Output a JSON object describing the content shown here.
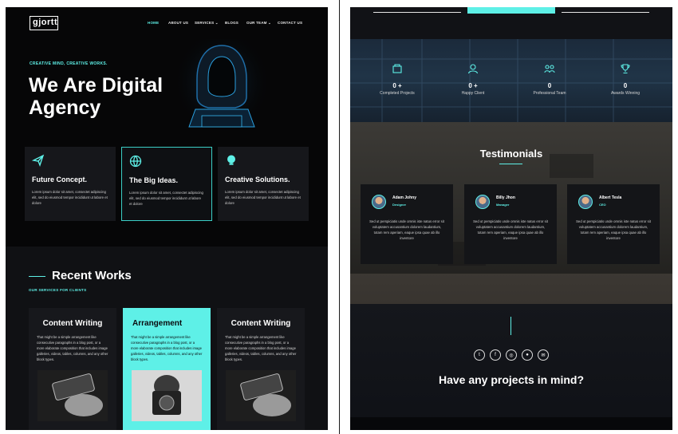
{
  "colors": {
    "accent": "#5ef0e7",
    "dark": "#0b0c10",
    "card": "#16171b"
  },
  "header": {
    "logo": "gjortt",
    "nav": [
      {
        "label": "HOME",
        "active": true
      },
      {
        "label": "ABOUT US"
      },
      {
        "label": "SERVICES ⌄"
      },
      {
        "label": "BLOGS"
      },
      {
        "label": "OUR TEAM ⌄"
      },
      {
        "label": "CONTACT US"
      }
    ]
  },
  "hero": {
    "eyebrow": "CREATIVE MIND, CREATIVE WORKS.",
    "title": "We Are Digital Agency",
    "image_icon": "hooded-hacker-illustration"
  },
  "features": [
    {
      "icon": "paper-plane-icon",
      "title": "Future Concept.",
      "desc": "Lorem ipsum dolor sit amet, consectet adipiscing elit, sed do eiusmod tempor incididunt ut labore et dolore"
    },
    {
      "icon": "globe-icon",
      "title": "The Big Ideas.",
      "desc": "Lorem ipsum dolor sit amet, consectet adipiscing elit, sed do eiusmod tempor incididunt ut labore et dolore"
    },
    {
      "icon": "lightbulb-icon",
      "title": "Creative Solutions.",
      "desc": "Lorem ipsum dolor sit amet, consectet adipiscing elit, sed do eiusmod tempor incididunt ut labore et dolore"
    }
  ],
  "works": {
    "title": "Recent Works",
    "subtitle": "OUR SERVICES FOR CLIENTS",
    "cards": [
      {
        "title": "Content Writing",
        "desc": "That might be a simple arrangement like consecutive paragraphs in a blog post, or a more elaborate composition that includes image galleries, videos, tables, columns, and any other block types."
      },
      {
        "title": "Arrangement",
        "desc": "That might be a simple arrangement like consecutive paragraphs in a blog post, or a more elaborate composition that includes image galleries, videos, tables, columns, and any other block types."
      },
      {
        "title": "Content Writing",
        "desc": "That might be a simple arrangement like consecutive paragraphs in a blog post, or a more elaborate composition that includes image galleries, videos, tables, columns, and any other block types."
      }
    ]
  },
  "stats": [
    {
      "icon": "projects-icon",
      "value": "0 +",
      "label": "Completed Projects"
    },
    {
      "icon": "client-icon",
      "value": "0 +",
      "label": "Happy Client"
    },
    {
      "icon": "team-icon",
      "value": "0",
      "label": "Professional Team"
    },
    {
      "icon": "trophy-icon",
      "value": "0",
      "label": "Awards Winning"
    }
  ],
  "testimonials": {
    "title": "Testimonials",
    "items": [
      {
        "name": "Adam Johny",
        "role": "Designer",
        "quote": "Sed ut perspiciatis unde omnis iste natus error sit voluptatem accusantium dolorem laudantium, totam rem aperiam, eaque ipsa quae ab illo inventore"
      },
      {
        "name": "Billy Jhon",
        "role": "Manager",
        "quote": "Sed ut perspiciatis unde omnis iste natus error sit voluptatem accusantium dolorem laudantium, totam rem aperiam, eaque ipsa quae ab illo inventore"
      },
      {
        "name": "Albert Tesla",
        "role": "CEO",
        "quote": "Sed ut perspiciatis unde omnis iste natus error sit voluptatem accusantium dolorem laudantium, totam rem aperiam, eaque ipsa quae ab illo inventore"
      }
    ]
  },
  "cta": {
    "socials": [
      {
        "icon": "twitter-icon",
        "glyph": "t"
      },
      {
        "icon": "facebook-icon",
        "glyph": "f"
      },
      {
        "icon": "instagram-icon",
        "glyph": "◎"
      },
      {
        "icon": "github-icon",
        "glyph": "●"
      },
      {
        "icon": "email-icon",
        "glyph": "✉"
      }
    ],
    "title": "Have any projects in mind?"
  }
}
